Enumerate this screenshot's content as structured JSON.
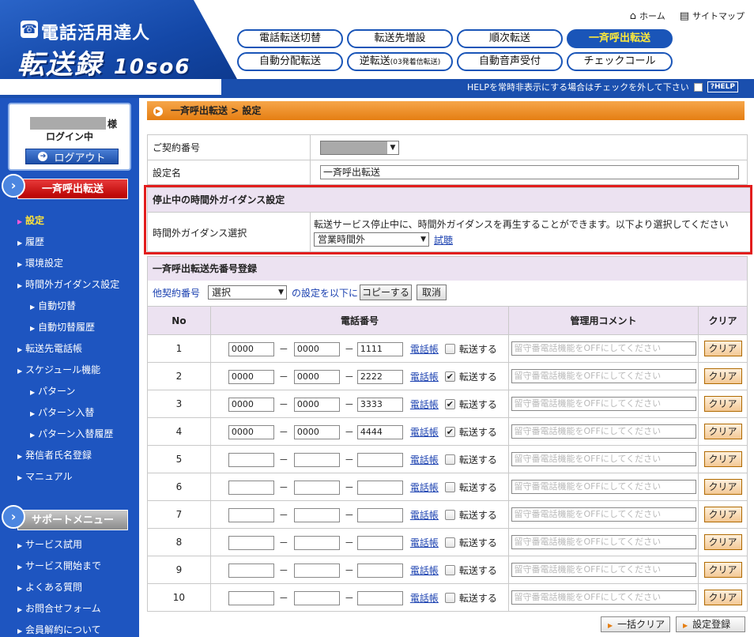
{
  "header": {
    "logo_sub": "電話活用達人",
    "logo_main": "転送録",
    "logo_version": "10so6",
    "home": "ホーム",
    "sitemap": "サイトマップ",
    "nav": [
      {
        "label": "電話転送切替"
      },
      {
        "label": "転送先増設"
      },
      {
        "label": "順次転送"
      },
      {
        "label": "一斉呼出転送",
        "active": true
      },
      {
        "label": "自動分配転送"
      },
      {
        "label": "逆転送",
        "small": "(03発着信転送)"
      },
      {
        "label": "自動音声受付"
      },
      {
        "label": "チェックコール"
      }
    ],
    "help_text": "HELPを常時非表示にする場合はチェックを外して下さい",
    "help_btn": "?HELP"
  },
  "sidebar": {
    "sama": "様",
    "login_status": "ログイン中",
    "logout": "ログアウト",
    "section1": "一斉呼出転送",
    "items1": [
      {
        "label": "設定",
        "current": true
      },
      {
        "label": "履歴"
      },
      {
        "label": "環境設定"
      },
      {
        "label": "時間外ガイダンス設定"
      },
      {
        "label": "自動切替",
        "sub": true
      },
      {
        "label": "自動切替履歴",
        "sub": true
      },
      {
        "label": "転送先電話帳"
      },
      {
        "label": "スケジュール機能"
      },
      {
        "label": "パターン",
        "sub": true
      },
      {
        "label": "パターン入替",
        "sub": true
      },
      {
        "label": "パターン入替履歴",
        "sub": true
      },
      {
        "label": "発信者氏名登録"
      },
      {
        "label": "マニュアル"
      }
    ],
    "section2": "サポートメニュー",
    "items2": [
      {
        "label": "サービス試用"
      },
      {
        "label": "サービス開始まで"
      },
      {
        "label": "よくある質問"
      },
      {
        "label": "お問合せフォーム"
      },
      {
        "label": "会員解約について"
      }
    ]
  },
  "breadcrumb": "一斉呼出転送 > 設定",
  "form": {
    "contract_label": "ご契約番号",
    "name_label": "設定名",
    "name_value": "一斉呼出転送"
  },
  "guidance": {
    "title": "停止中の時間外ガイダンス設定",
    "label": "時間外ガイダンス選択",
    "desc": "転送サービス停止中に、時間外ガイダンスを再生することができます。以下より選択してください",
    "selected": "営業時間外",
    "trial": "試聴"
  },
  "registration": {
    "title": "一斉呼出転送先番号登録",
    "other_label": "他契約番号",
    "other_selected": "選択",
    "copy_suffix": "の設定を以下に",
    "copy_btn": "コピーする",
    "cancel_btn": "取消",
    "headers": {
      "no": "No",
      "phone": "電話番号",
      "comment": "管理用コメント",
      "clear": "クリア"
    },
    "phonebook": "電話帳",
    "transfer": "転送する",
    "comment_placeholder": "留守番電話機能をOFFにしてください",
    "clear": "クリア",
    "dash": "－",
    "rows": [
      {
        "no": "1",
        "p1": "0000",
        "p2": "0000",
        "p3": "1111",
        "checked": false
      },
      {
        "no": "2",
        "p1": "0000",
        "p2": "0000",
        "p3": "2222",
        "checked": true
      },
      {
        "no": "3",
        "p1": "0000",
        "p2": "0000",
        "p3": "3333",
        "checked": true
      },
      {
        "no": "4",
        "p1": "0000",
        "p2": "0000",
        "p3": "4444",
        "checked": true
      },
      {
        "no": "5",
        "p1": "",
        "p2": "",
        "p3": "",
        "checked": false
      },
      {
        "no": "6",
        "p1": "",
        "p2": "",
        "p3": "",
        "checked": false
      },
      {
        "no": "7",
        "p1": "",
        "p2": "",
        "p3": "",
        "checked": false
      },
      {
        "no": "8",
        "p1": "",
        "p2": "",
        "p3": "",
        "checked": false
      },
      {
        "no": "9",
        "p1": "",
        "p2": "",
        "p3": "",
        "checked": false
      },
      {
        "no": "10",
        "p1": "",
        "p2": "",
        "p3": "",
        "checked": false
      }
    ]
  },
  "footer_buttons": {
    "clear_all": "一括クリア",
    "save": "設定登録"
  }
}
